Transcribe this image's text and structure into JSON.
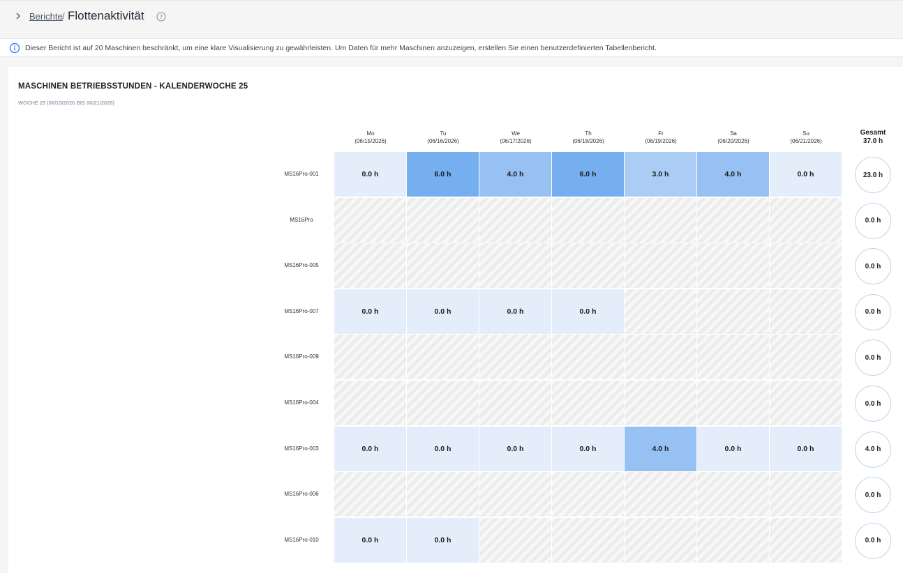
{
  "header": {
    "breadcrumb_link": "Berichte",
    "separator": "/",
    "title": "Flottenaktivität",
    "chevron_icon": "chevron-right-icon",
    "help_icon": "help-circle-icon"
  },
  "banner": {
    "icon": "info-icon",
    "text": "Dieser Bericht ist auf 20 Maschinen beschränkt, um eine klare Visualisierung zu gewährleisten. Um Daten für mehr Maschinen anzuzeigen, erstellen Sie einen benutzerdefinierten Tabellenbericht."
  },
  "report": {
    "title": "MASCHINEN BETRIEBSSTUNDEN - KALENDERWOCHE 25",
    "subtitle": "WOCHE 25 (06/15/2026 BIS 06/21/2026)",
    "total_label": "Gesamt",
    "total_value": "37.0 h"
  },
  "colors": {
    "empty_cell": "#efefef",
    "scale_0": "#e4eefb",
    "scale_3": "#abcdf5",
    "scale_4": "#97c0f3",
    "scale_6": "#75aff0",
    "circle_border": "#bfd4ea"
  },
  "days": [
    {
      "name": "Mo",
      "date": "(06/15/2026)"
    },
    {
      "name": "Tu",
      "date": "(06/16/2026)"
    },
    {
      "name": "We",
      "date": "(06/17/2026)"
    },
    {
      "name": "Th",
      "date": "(06/18/2026)"
    },
    {
      "name": "Fr",
      "date": "(06/19/2026)"
    },
    {
      "name": "Sa",
      "date": "(06/20/2026)"
    },
    {
      "name": "Su",
      "date": "(06/21/2026)"
    }
  ],
  "chart_data": {
    "type": "heatmap",
    "title": "MASCHINEN BETRIEBSSTUNDEN - KALENDERWOCHE 25",
    "columns": [
      "Mo",
      "Tu",
      "We",
      "Th",
      "Fr",
      "Sa",
      "Su"
    ],
    "unit": "h",
    "rows": [
      {
        "machine": "MS16Pro-001",
        "values": [
          0.0,
          6.0,
          4.0,
          6.0,
          3.0,
          4.0,
          0.0
        ],
        "total": "23.0 h"
      },
      {
        "machine": "MS16Pro",
        "values": [
          null,
          null,
          null,
          null,
          null,
          null,
          null
        ],
        "total": "0.0 h"
      },
      {
        "machine": "MS16Pro-005",
        "values": [
          null,
          null,
          null,
          null,
          null,
          null,
          null
        ],
        "total": "0.0 h"
      },
      {
        "machine": "MS16Pro-007",
        "values": [
          0.0,
          0.0,
          0.0,
          0.0,
          null,
          null,
          null
        ],
        "total": "0.0 h"
      },
      {
        "machine": "MS16Pro-009",
        "values": [
          null,
          null,
          null,
          null,
          null,
          null,
          null
        ],
        "total": "0.0 h"
      },
      {
        "machine": "MS16Pro-004",
        "values": [
          null,
          null,
          null,
          null,
          null,
          null,
          null
        ],
        "total": "0.0 h"
      },
      {
        "machine": "MS16Pro-003",
        "values": [
          0.0,
          0.0,
          0.0,
          0.0,
          4.0,
          0.0,
          0.0
        ],
        "total": "4.0 h"
      },
      {
        "machine": "MS16Pro-006",
        "values": [
          null,
          null,
          null,
          null,
          null,
          null,
          null
        ],
        "total": "0.0 h"
      },
      {
        "machine": "MS16Pro-010",
        "values": [
          0.0,
          0.0,
          null,
          null,
          null,
          null,
          null
        ],
        "total": "0.0 h"
      }
    ]
  }
}
